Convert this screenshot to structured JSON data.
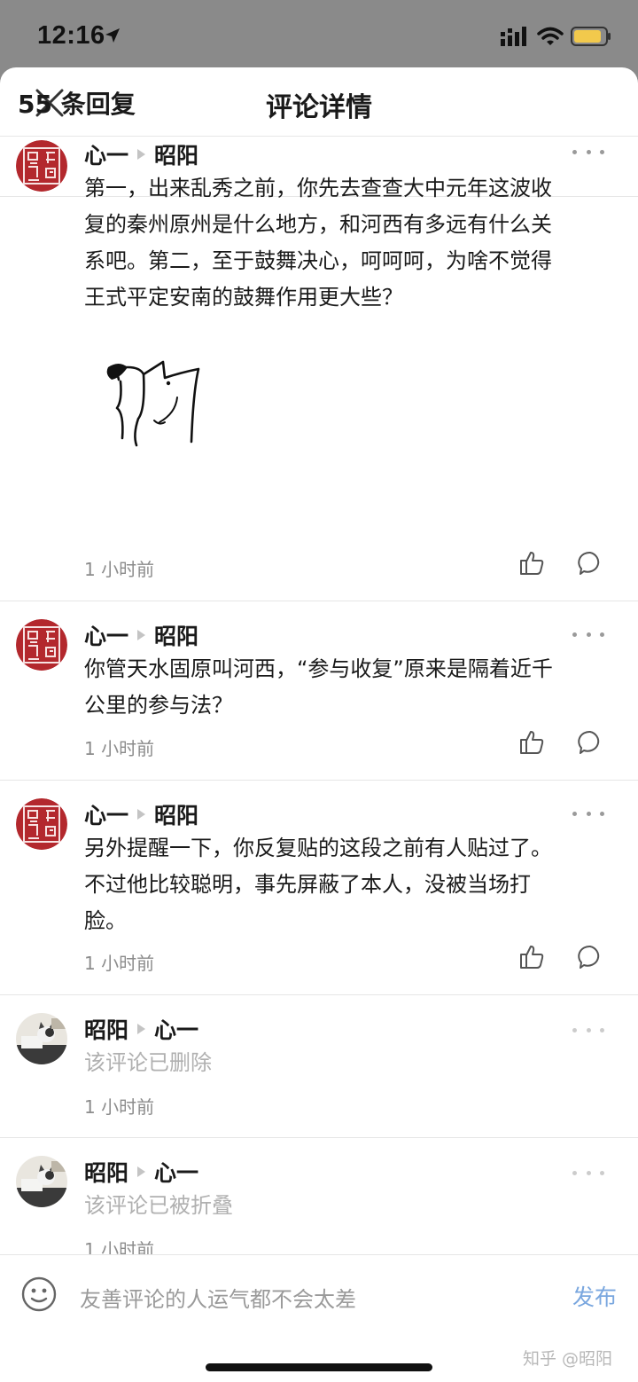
{
  "status_bar": {
    "time": "12:16"
  },
  "header": {
    "title": "评论详情"
  },
  "reply_count": "55 条回复",
  "comments": [
    {
      "author": "心一",
      "reply_to": "昭阳",
      "text_lines": [
        "第一，出来乱秀之前，你先去查查大中元年这波收",
        "复的秦州原州是什么地方，和河西有多远有什么关",
        "系吧。第二，至于鼓舞决心，呵呵呵，为啥不觉得",
        "王式平定安南的鼓舞作用更大些？"
      ],
      "time": "1 小时前",
      "has_sticker": true
    },
    {
      "author": "心一",
      "reply_to": "昭阳",
      "text_lines": [
        "你管天水固原叫河西，“参与收复”原来是隔着近千",
        "公里的参与法？"
      ],
      "time": "1 小时前"
    },
    {
      "author": "心一",
      "reply_to": "昭阳",
      "text_lines": [
        "另外提醒一下，你反复贴的这段之前有人贴过了。",
        "不过他比较聪明，事先屏蔽了本人，没被当场打",
        "脸。"
      ],
      "time": "1 小时前"
    },
    {
      "author": "昭阳",
      "reply_to": "心一",
      "text_lines": [
        "该评论已删除"
      ],
      "time": "1 小时前"
    },
    {
      "author": "昭阳",
      "reply_to": "心一",
      "text_lines": [
        "该评论已被折叠"
      ],
      "time": "1 小时前"
    }
  ],
  "input": {
    "placeholder": "友善评论的人运气都不会太差",
    "publish_label": "发布"
  },
  "watermark": "知乎 @昭阳",
  "colors": {
    "accent": "#7aa7df",
    "seal_red": "#b3282d",
    "divider": "#e6e6e6"
  },
  "icons": [
    "location-arrow-icon",
    "signal-icon",
    "wifi-icon",
    "battery-icon",
    "close-icon",
    "more-icon",
    "like-icon",
    "reply-icon",
    "emoji-icon"
  ]
}
